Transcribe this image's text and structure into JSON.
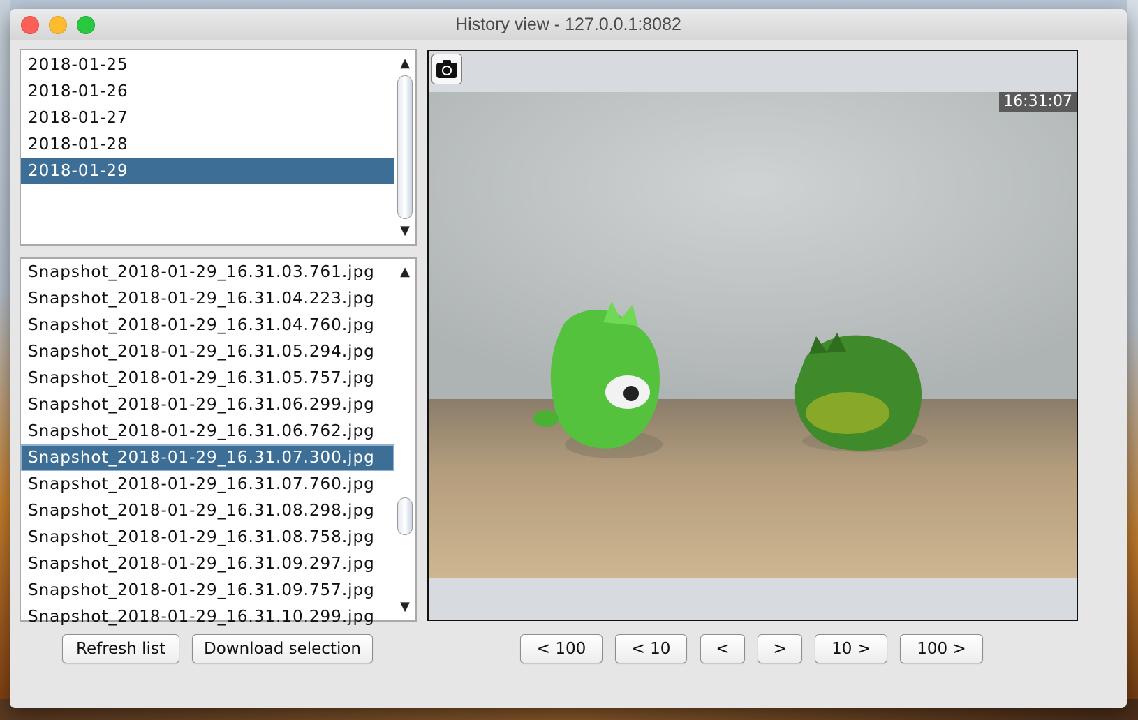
{
  "window": {
    "title": "History view - 127.0.0.1:8082"
  },
  "dates": {
    "items": [
      "2018-01-25",
      "2018-01-26",
      "2018-01-27",
      "2018-01-28",
      "2018-01-29"
    ],
    "selected": "2018-01-29"
  },
  "snapshots": {
    "items": [
      "Snapshot_2018-01-29_16.31.03.761.jpg",
      "Snapshot_2018-01-29_16.31.04.223.jpg",
      "Snapshot_2018-01-29_16.31.04.760.jpg",
      "Snapshot_2018-01-29_16.31.05.294.jpg",
      "Snapshot_2018-01-29_16.31.05.757.jpg",
      "Snapshot_2018-01-29_16.31.06.299.jpg",
      "Snapshot_2018-01-29_16.31.06.762.jpg",
      "Snapshot_2018-01-29_16.31.07.300.jpg",
      "Snapshot_2018-01-29_16.31.07.760.jpg",
      "Snapshot_2018-01-29_16.31.08.298.jpg",
      "Snapshot_2018-01-29_16.31.08.758.jpg",
      "Snapshot_2018-01-29_16.31.09.297.jpg",
      "Snapshot_2018-01-29_16.31.09.757.jpg",
      "Snapshot_2018-01-29_16.31.10.299.jpg"
    ],
    "selected": "Snapshot_2018-01-29_16.31.07.300.jpg"
  },
  "viewer": {
    "timestamp": "16:31:07",
    "camera_icon": "camera-icon"
  },
  "buttons": {
    "refresh": "Refresh list",
    "download": "Download selection",
    "back100": "< 100",
    "back10": "< 10",
    "back1": "<",
    "fwd1": ">",
    "fwd10": "10 >",
    "fwd100": "100 >"
  },
  "colors": {
    "selection": "#3d6f96",
    "close": "#fc5f57",
    "minimize": "#fdbc2e",
    "maximize": "#28c840"
  }
}
